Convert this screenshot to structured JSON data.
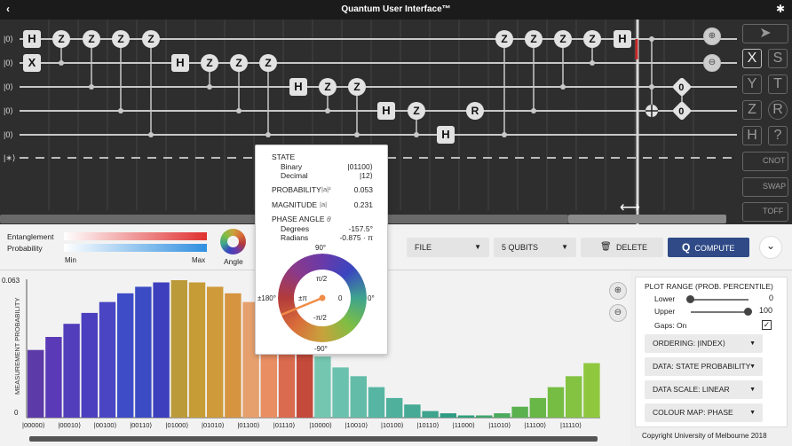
{
  "titlebar": {
    "title": "Quantum User Interface™",
    "back_glyph": "‹",
    "settings_glyph": "✱"
  },
  "circuit": {
    "qubit_labels": [
      "|0⟩",
      "|0⟩",
      "|0⟩",
      "|0⟩",
      "|0⟩",
      "|∗⟩"
    ],
    "gate_letters": {
      "h": "H",
      "x": "X",
      "z": "Z",
      "r": "R",
      "zero": "0"
    }
  },
  "palette": {
    "x": "X",
    "s": "S",
    "y": "Y",
    "t": "T",
    "z": "Z",
    "r": "R",
    "h": "H",
    "q": "?",
    "cnot": "CNOT",
    "swap": "SWAP",
    "toff": "TOFF"
  },
  "controls": {
    "entanglement_label": "Entanglement",
    "probability_label": "Probability",
    "min_label": "Min",
    "max_label": "Max",
    "angle_label": "Angle",
    "file_label": "FILE",
    "qubits_label": "5 QUBITS",
    "delete_label": "DELETE",
    "compute_label": "COMPUTE",
    "compute_icon": "Q",
    "delete_icon": "🗑",
    "more_glyph": "⌄"
  },
  "colors": {
    "compute_bg": "#2f4a86",
    "entanglement_high": "#e03131",
    "probability_high": "#2f8fe0",
    "gate_bg": "#e2e2e2",
    "circuit_bg": "#2e2e2e",
    "cursor_line": "#d9d9d9"
  },
  "tooltip": {
    "state_heading": "STATE",
    "binary_label": "Binary",
    "binary_value": "|01100⟩",
    "decimal_label": "Decimal",
    "decimal_value": "|12⟩",
    "probability_label": "PROBABILITY",
    "probability_symbol": "|a|²",
    "probability_value": "0.053",
    "magnitude_label": "MAGNITUDE",
    "magnitude_symbol": "|a|",
    "magnitude_value": "0.231",
    "phase_heading": "PHASE ANGLE",
    "phase_symbol": "θ",
    "degrees_label": "Degrees",
    "degrees_value": "-157.5°",
    "radians_label": "Radians",
    "radians_value": "-0.875 · π",
    "wheel": {
      "top": "90°",
      "bottom": "-90°",
      "left": "±180°",
      "right": "0°",
      "inner_top": "π/2",
      "inner_bottom": "-π/2",
      "inner_left": "±π",
      "inner_right": "0"
    }
  },
  "plot": {
    "zoom_in_glyph": "+",
    "zoom_out_glyph": "−"
  },
  "settings": {
    "plot_range_title": "PLOT RANGE (PROB. PERCENTILE)",
    "lower_label": "Lower",
    "lower_value": "0",
    "upper_label": "Upper",
    "upper_value": "100",
    "gaps_label": "Gaps: On",
    "gaps_checked": true,
    "ordering": "ORDERING: |INDEX⟩",
    "data": "DATA: STATE PROBABILITY",
    "scale": "DATA SCALE: LINEAR",
    "colour_map": "COLOUR MAP: PHASE"
  },
  "copyright": "Copyright University of Melbourne 2018",
  "chart_data": {
    "type": "bar",
    "ylabel": "MEASUREMENT PROBABILITY",
    "ylim": [
      0,
      0.063
    ],
    "ytick_labels": [
      "0.063",
      "0"
    ],
    "x_tick_labels": [
      "|00000⟩",
      "|00010⟩",
      "|00100⟩",
      "|00110⟩",
      "|01000⟩",
      "|01010⟩",
      "|01100⟩",
      "|01110⟩",
      "|10000⟩",
      "|10010⟩",
      "|10100⟩",
      "|10110⟩",
      "|11000⟩",
      "|11010⟩",
      "|11100⟩",
      "|11110⟩"
    ],
    "values": [
      0.031,
      0.037,
      0.043,
      0.048,
      0.053,
      0.057,
      0.06,
      0.062,
      0.063,
      0.062,
      0.06,
      0.057,
      0.053,
      0.048,
      0.043,
      0.037,
      0.028,
      0.023,
      0.019,
      0.014,
      0.009,
      0.006,
      0.003,
      0.002,
      0.001,
      0.001,
      0.002,
      0.005,
      0.009,
      0.014,
      0.019,
      0.025
    ],
    "colors": [
      "#5c3aa8",
      "#5a3ab6",
      "#523dbb",
      "#4b3fbf",
      "#4a45c3",
      "#3e4cc7",
      "#3a4bc4",
      "#3d3fbd",
      "#bb9a3a",
      "#c59c36",
      "#cf9a3a",
      "#d69440",
      "#e6a06e",
      "#e98e62",
      "#da6b4e",
      "#c44a3b",
      "#74c6b0",
      "#6ac1ae",
      "#62bca8",
      "#57b6a3",
      "#4fb09c",
      "#46aa96",
      "#3ea48e",
      "#2e9c83",
      "#2f9f7c",
      "#3ea56b",
      "#4aab5c",
      "#5ab14e",
      "#68b747",
      "#76bd43",
      "#83c341",
      "#8fc83f"
    ],
    "tooltip_index": 12,
    "grid": false
  }
}
